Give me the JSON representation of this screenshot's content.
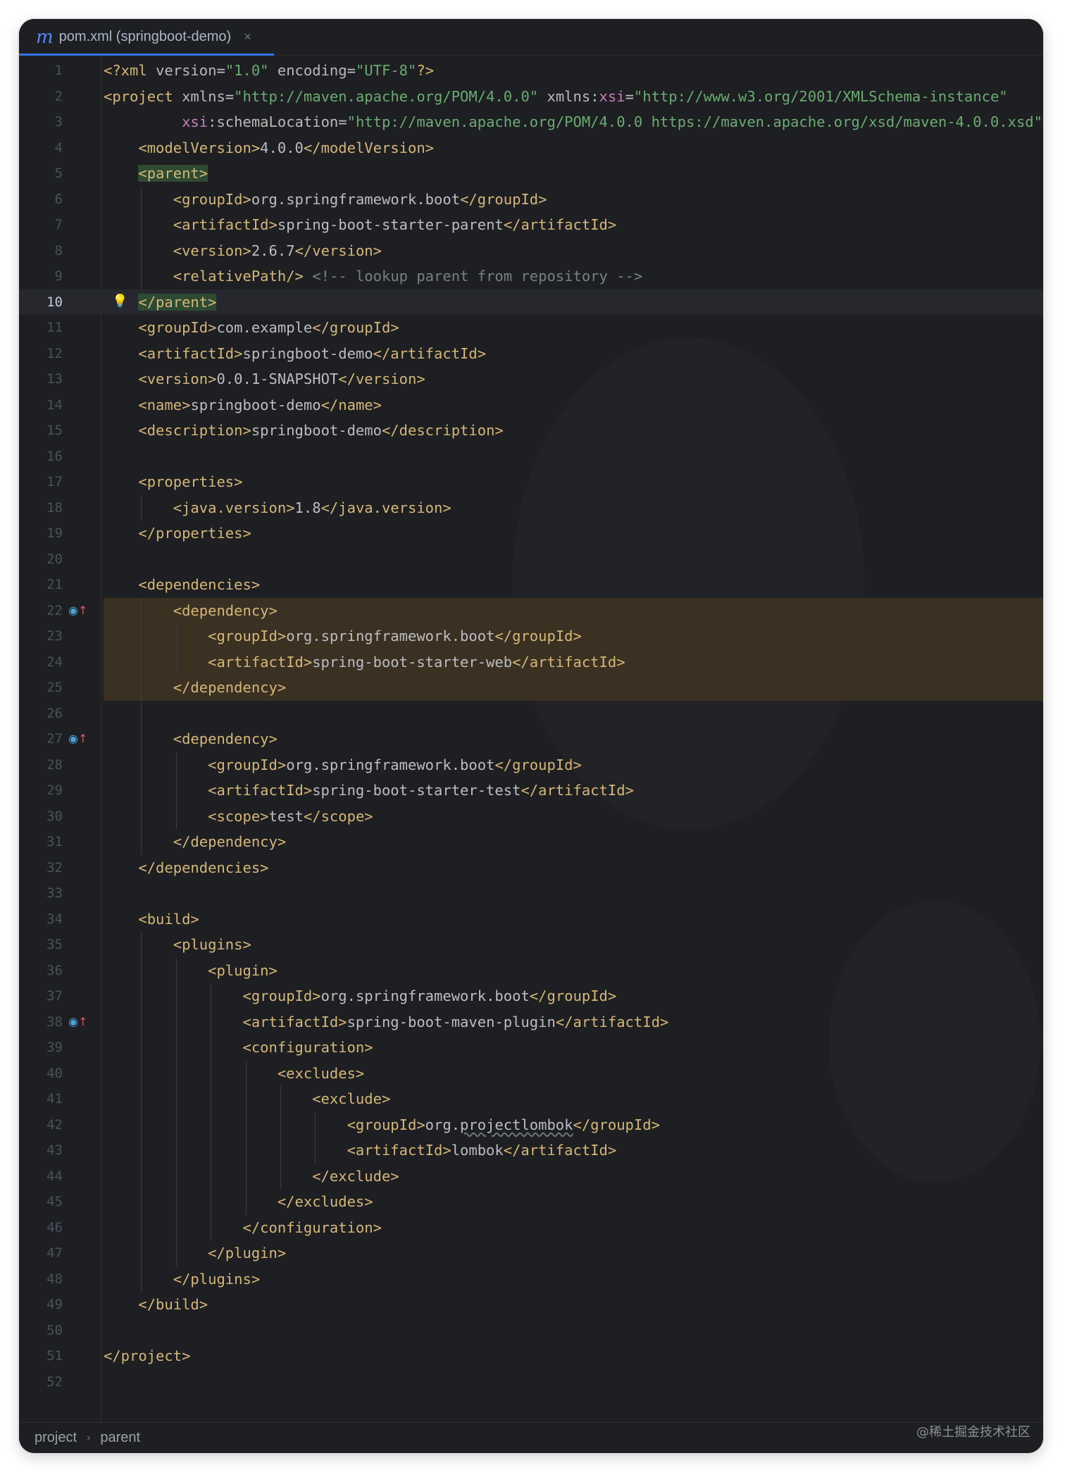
{
  "tab": {
    "file_icon": "m",
    "title": "pom.xml (springboot-demo)",
    "close": "×"
  },
  "editor": {
    "current_line": 10,
    "lines": [
      {
        "n": "1",
        "html": "<span class='c-tag'>&lt;?xml</span> <span class='c-attr'>version</span>=<span class='c-str'>\"1.0\"</span> <span class='c-attr'>encoding</span>=<span class='c-str'>\"UTF-8\"</span><span class='c-tag'>?&gt;</span>"
      },
      {
        "n": "2",
        "html": "<span class='c-tag'>&lt;project</span> <span class='c-attr'>xmlns</span>=<span class='c-str'>\"http://maven.apache.org/POM/4.0.0\"</span> <span class='c-attr'>xmlns</span>:<span class='c-ns'>xsi</span>=<span class='c-str'>\"http://www.w3.org/2001/XMLSchema-instance\"</span>"
      },
      {
        "n": "3",
        "html": "         <span class='c-ns'>xsi</span>:<span class='c-attr'>schemaLocation</span>=<span class='c-str'>\"http://maven.apache.org/POM/4.0.0 https://maven.apache.org/xsd/maven-4.0.0.xsd\"</span><span class='c-tag'>&gt;</span>"
      },
      {
        "n": "4",
        "html": "    <span class='c-tag'>&lt;modelVersion&gt;</span>4.0.0<span class='c-tag'>&lt;/modelVersion&gt;</span>"
      },
      {
        "n": "5",
        "html": "    <span class='c-tag tag-hl'>&lt;parent&gt;</span>"
      },
      {
        "n": "6",
        "html": "        <span class='c-tag'>&lt;groupId&gt;</span>org.springframework.boot<span class='c-tag'>&lt;/groupId&gt;</span>"
      },
      {
        "n": "7",
        "html": "        <span class='c-tag'>&lt;artifactId&gt;</span>spring-boot-starter-parent<span class='c-tag'>&lt;/artifactId&gt;</span>"
      },
      {
        "n": "8",
        "html": "        <span class='c-tag'>&lt;version&gt;</span>2.6.7<span class='c-tag'>&lt;/version&gt;</span>"
      },
      {
        "n": "9",
        "html": "        <span class='c-tag'>&lt;relativePath/&gt;</span> <span class='c-com'>&lt;!-- lookup parent from repository --&gt;</span>"
      },
      {
        "n": "10",
        "html": "    <span class='c-tag tag-hl'>&lt;/parent&gt;</span>"
      },
      {
        "n": "11",
        "html": "    <span class='c-tag'>&lt;groupId&gt;</span>com.example<span class='c-tag'>&lt;/groupId&gt;</span>"
      },
      {
        "n": "12",
        "html": "    <span class='c-tag'>&lt;artifactId&gt;</span>springboot-demo<span class='c-tag'>&lt;/artifactId&gt;</span>"
      },
      {
        "n": "13",
        "html": "    <span class='c-tag'>&lt;version&gt;</span>0.0.1-SNAPSHOT<span class='c-tag'>&lt;/version&gt;</span>"
      },
      {
        "n": "14",
        "html": "    <span class='c-tag'>&lt;name&gt;</span>springboot-demo<span class='c-tag'>&lt;/name&gt;</span>"
      },
      {
        "n": "15",
        "html": "    <span class='c-tag'>&lt;description&gt;</span>springboot-demo<span class='c-tag'>&lt;/description&gt;</span>"
      },
      {
        "n": "16",
        "html": ""
      },
      {
        "n": "17",
        "html": "    <span class='c-tag'>&lt;properties&gt;</span>"
      },
      {
        "n": "18",
        "html": "        <span class='c-tag'>&lt;java.version&gt;</span>1.8<span class='c-tag'>&lt;/java.version&gt;</span>"
      },
      {
        "n": "19",
        "html": "    <span class='c-tag'>&lt;/properties&gt;</span>"
      },
      {
        "n": "20",
        "html": ""
      },
      {
        "n": "21",
        "html": "    <span class='c-tag'>&lt;dependencies&gt;</span>"
      },
      {
        "n": "22",
        "html": "        <span class='c-tag'>&lt;dependency&gt;</span>",
        "marker": true
      },
      {
        "n": "23",
        "html": "            <span class='c-tag'>&lt;groupId&gt;</span>org.springframework.boot<span class='c-tag'>&lt;/groupId&gt;</span>"
      },
      {
        "n": "24",
        "html": "            <span class='c-tag'>&lt;artifactId&gt;</span>spring-boot-starter-web<span class='c-tag'>&lt;/artifactId&gt;</span>"
      },
      {
        "n": "25",
        "html": "        <span class='c-tag'>&lt;/dependency&gt;</span>"
      },
      {
        "n": "26",
        "html": ""
      },
      {
        "n": "27",
        "html": "        <span class='c-tag'>&lt;dependency&gt;</span>",
        "marker": true
      },
      {
        "n": "28",
        "html": "            <span class='c-tag'>&lt;groupId&gt;</span>org.springframework.boot<span class='c-tag'>&lt;/groupId&gt;</span>"
      },
      {
        "n": "29",
        "html": "            <span class='c-tag'>&lt;artifactId&gt;</span>spring-boot-starter-test<span class='c-tag'>&lt;/artifactId&gt;</span>"
      },
      {
        "n": "30",
        "html": "            <span class='c-tag'>&lt;scope&gt;</span>test<span class='c-tag'>&lt;/scope&gt;</span>"
      },
      {
        "n": "31",
        "html": "        <span class='c-tag'>&lt;/dependency&gt;</span>"
      },
      {
        "n": "32",
        "html": "    <span class='c-tag'>&lt;/dependencies&gt;</span>"
      },
      {
        "n": "33",
        "html": ""
      },
      {
        "n": "34",
        "html": "    <span class='c-tag'>&lt;build&gt;</span>"
      },
      {
        "n": "35",
        "html": "        <span class='c-tag'>&lt;plugins&gt;</span>"
      },
      {
        "n": "36",
        "html": "            <span class='c-tag'>&lt;plugin&gt;</span>"
      },
      {
        "n": "37",
        "html": "                <span class='c-tag'>&lt;groupId&gt;</span>org.springframework.boot<span class='c-tag'>&lt;/groupId&gt;</span>"
      },
      {
        "n": "38",
        "html": "                <span class='c-tag'>&lt;artifactId&gt;</span>spring-boot-maven-plugin<span class='c-tag'>&lt;/artifactId&gt;</span>",
        "marker": true
      },
      {
        "n": "39",
        "html": "                <span class='c-tag'>&lt;configuration&gt;</span>"
      },
      {
        "n": "40",
        "html": "                    <span class='c-tag'>&lt;excludes&gt;</span>"
      },
      {
        "n": "41",
        "html": "                        <span class='c-tag'>&lt;exclude&gt;</span>"
      },
      {
        "n": "42",
        "html": "                            <span class='c-tag'>&lt;groupId&gt;</span>org.<span class='squiggle'>projectlombok</span><span class='c-tag'>&lt;/groupId&gt;</span>"
      },
      {
        "n": "43",
        "html": "                            <span class='c-tag'>&lt;artifactId&gt;</span>lombok<span class='c-tag'>&lt;/artifactId&gt;</span>"
      },
      {
        "n": "44",
        "html": "                        <span class='c-tag'>&lt;/exclude&gt;</span>"
      },
      {
        "n": "45",
        "html": "                    <span class='c-tag'>&lt;/excludes&gt;</span>"
      },
      {
        "n": "46",
        "html": "                <span class='c-tag'>&lt;/configuration&gt;</span>"
      },
      {
        "n": "47",
        "html": "            <span class='c-tag'>&lt;/plugin&gt;</span>"
      },
      {
        "n": "48",
        "html": "        <span class='c-tag'>&lt;/plugins&gt;</span>"
      },
      {
        "n": "49",
        "html": "    <span class='c-tag'>&lt;/build&gt;</span>"
      },
      {
        "n": "50",
        "html": ""
      },
      {
        "n": "51",
        "html": "<span class='c-tag'>&lt;/project&gt;</span>"
      },
      {
        "n": "52",
        "html": ""
      }
    ]
  },
  "statusbar": {
    "crumbs": [
      "project",
      "parent"
    ],
    "separator": "›"
  },
  "watermark": "@稀土掘金技术社区",
  "colors": {
    "background": "#1e1f22",
    "tag": "#d5b778",
    "string": "#6aab73",
    "comment": "#7a7e85",
    "namespace": "#c77dbb",
    "accent": "#3574f0"
  }
}
